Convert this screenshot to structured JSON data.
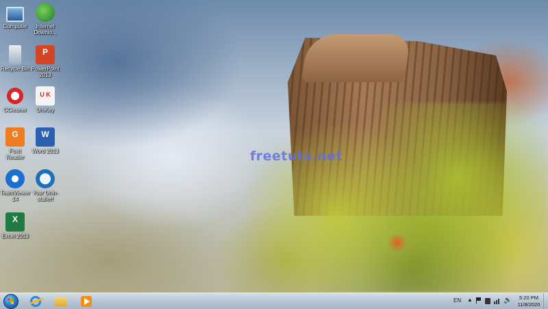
{
  "desktop": {
    "watermark": "freetuts.net",
    "icons": [
      {
        "label": "Computer",
        "icon": "computer-icon"
      },
      {
        "label": "Internet Downlo...",
        "icon": "idm-icon"
      },
      {
        "label": "Recycle Bin",
        "icon": "recycle-bin-icon"
      },
      {
        "label": "PowerPoint 2013",
        "icon": "powerpoint-icon"
      },
      {
        "label": "CCleaner",
        "icon": "ccleaner-icon"
      },
      {
        "label": "UniKey",
        "icon": "unikey-icon"
      },
      {
        "label": "Foxit Reader",
        "icon": "foxit-reader-icon"
      },
      {
        "label": "Word 2013",
        "icon": "word-icon"
      },
      {
        "label": "TeamViewer 14",
        "icon": "teamviewer-icon"
      },
      {
        "label": "Your Unin-staller!",
        "icon": "uninstaller-icon"
      },
      {
        "label": "Excel 2013",
        "icon": "excel-icon"
      }
    ]
  },
  "taskbar": {
    "start": "start-orb-icon",
    "pinned": [
      {
        "icon": "internet-explorer-icon"
      },
      {
        "icon": "file-explorer-icon"
      },
      {
        "icon": "media-player-icon"
      }
    ],
    "tray": {
      "language": "EN",
      "time": "5:20 PM",
      "date": "11/8/2020"
    }
  }
}
